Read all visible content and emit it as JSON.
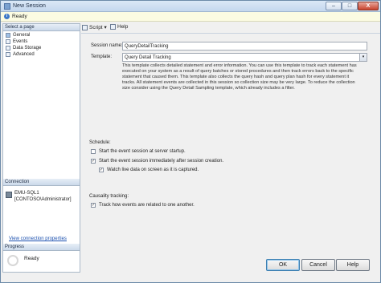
{
  "window": {
    "title": "New Session",
    "minimize": "–",
    "maximize": "□",
    "close": "X"
  },
  "status": {
    "text": "Ready"
  },
  "left": {
    "select_page_header": "Select a page",
    "pages": [
      "General",
      "Events",
      "Data Storage",
      "Advanced"
    ],
    "connection_header": "Connection",
    "server": "EMU-SQL1",
    "user": "[CONTOSO\\Administrator]",
    "view_connection_link": "View connection properties",
    "progress_header": "Progress",
    "progress_status": "Ready"
  },
  "toolbar": {
    "script_label": "Script",
    "script_arrow": "▾",
    "help_label": "Help"
  },
  "form": {
    "session_name_label": "Session name:",
    "session_name_value": "QueryDetailTracking",
    "template_label": "Template:",
    "template_value": "Query Detail Tracking",
    "template_arrow": "▾",
    "description": "This template collects detailed statement and error information. You can use this template to track each statement has executed on your system as a result of query batches or stored procedures and then track errors back to the specific statement that caused them. This template also collects the query hash and query plan hash for every statement it tracks. All statement events are collected in this session so collection size may be very large. To reduce the collection size consider using the Query Detail Sampling template, which already includes a filter.",
    "schedule_label": "Schedule:",
    "opt_start_server": "Start the event session at server startup.",
    "opt_start_immediately": "Start the event session immediately after session creation.",
    "opt_watch_live": "Watch live data on screen as it is captured.",
    "causality_label": "Causality tracking:",
    "opt_track_events": "Track how events are related to one another.",
    "check_mark": "✓",
    "checked": {
      "start_server": false,
      "start_immediately": true,
      "watch_live": true,
      "track_events": true
    }
  },
  "buttons": {
    "ok": "OK",
    "cancel": "Cancel",
    "help": "Help"
  }
}
